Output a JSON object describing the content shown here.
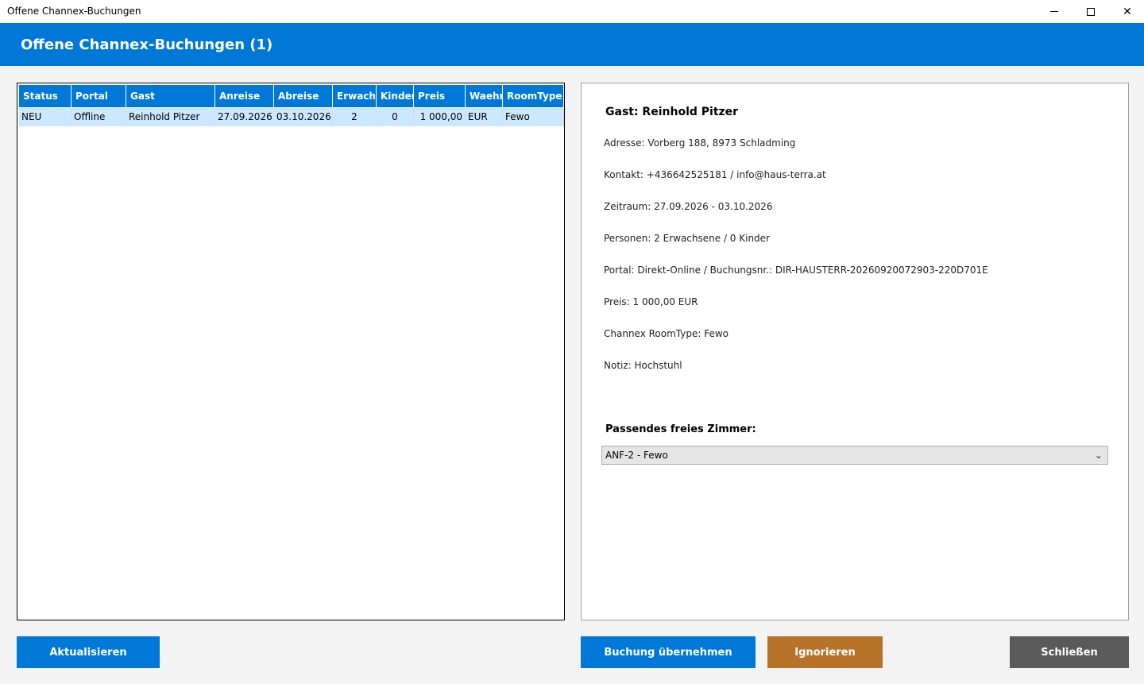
{
  "window": {
    "title": "Offene Channex-Buchungen"
  },
  "header": {
    "title": "Offene Channex-Buchungen (1)"
  },
  "grid": {
    "columns": [
      "Status",
      "Portal",
      "Gast",
      "Anreise",
      "Abreise",
      "Erwachsene",
      "Kinder",
      "Preis",
      "Waehr",
      "RoomType"
    ],
    "rows": [
      {
        "status": "NEU",
        "portal": "Offline",
        "gast": "Reinhold Pitzer",
        "anreise": "27.09.2026",
        "abreise": "03.10.2026",
        "erwachsene": "2",
        "kinder": "0",
        "preis": "1 000,00",
        "waehr": "EUR",
        "roomtype": "Fewo"
      }
    ]
  },
  "detail": {
    "guest": "Gast: Reinhold Pitzer",
    "address": "Adresse: Vorberg 188, 8973 Schladming",
    "contact": "Kontakt: +436642525181 / info@haus-terra.at",
    "period": "Zeitraum: 27.09.2026 - 03.10.2026",
    "persons": "Personen: 2 Erwachsene / 0 Kinder",
    "portal": "Portal: Direkt-Online / Buchungsnr.: DIR-HAUSTERR-20260920072903-220D701E",
    "price": "Preis: 1 000,00 EUR",
    "roomtype": "Channex RoomType: Fewo",
    "note": "Notiz: Hochstuhl",
    "room_label": "Passendes freies Zimmer:",
    "room_selected": "ANF-2 - Fewo"
  },
  "buttons": {
    "refresh": "Aktualisieren",
    "accept": "Buchung übernehmen",
    "ignore": "Ignorieren",
    "close": "Schließen"
  },
  "colors": {
    "accent": "#0078d7",
    "ignore": "#b8732a",
    "close": "#5a5a5a",
    "selected_row": "#cce8ff"
  }
}
